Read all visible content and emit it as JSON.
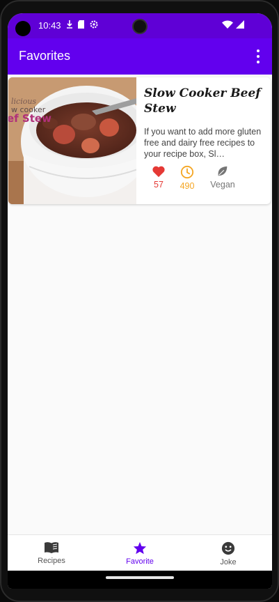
{
  "status_bar": {
    "time": "10:43",
    "icons_left": [
      "download-icon",
      "sd-card-icon",
      "settings-icon"
    ],
    "icons_right": [
      "wifi-icon",
      "cell-signal-icon"
    ],
    "color": "#5f00d6"
  },
  "app_bar": {
    "title": "Favorites",
    "menu_icon": "more-vert-icon",
    "color": "#6200ee"
  },
  "favorites": [
    {
      "title": "Slow Cooker Beef Stew",
      "description": "If you want to add more gluten free and dairy free recipes to your recipe box, Sl…",
      "image_overlay_text": [
        "licious",
        "w cooker",
        "ef Stew"
      ],
      "likes": "57",
      "minutes": "490",
      "vegan_label": "Vegan",
      "like_color": "#e53935",
      "time_color": "#f5a623",
      "vegan_color": "#757575"
    }
  ],
  "bottom_nav": {
    "items": [
      {
        "label": "Recipes",
        "icon": "menu-book-icon",
        "active": false
      },
      {
        "label": "Favorite",
        "icon": "star-icon",
        "active": true
      },
      {
        "label": "Joke",
        "icon": "smiley-icon",
        "active": false
      }
    ],
    "active_color": "#6200ee"
  }
}
